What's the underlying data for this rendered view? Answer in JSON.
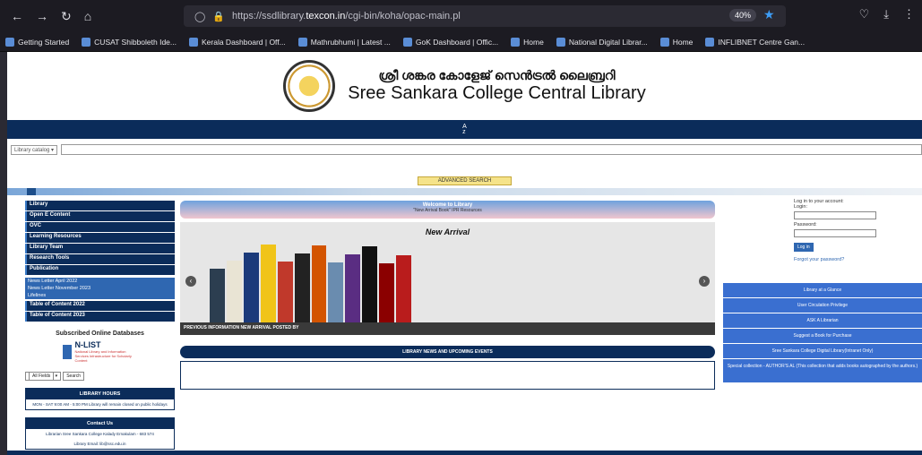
{
  "browser": {
    "url_prefix": "https://ssdlibrary.",
    "url_domain": "texcon.in",
    "url_suffix": "/cgi-bin/koha/opac-main.pl",
    "zoom": "40%"
  },
  "bookmarks": [
    "Getting Started",
    "CUSAT Shibboleth Ide...",
    "Kerala Dashboard | Off...",
    "Mathrubhumi | Latest ...",
    "GoK Dashboard | Offic...",
    "Home",
    "National Digital Librar...",
    "Home",
    "INFLIBNET Centre Gan..."
  ],
  "site": {
    "title_ml": "ശ്രീ ശങ്കര കോളേജ് സെൻട്രൽ ലൈബ്രറി",
    "title_en": "Sree Sankara College Central Library",
    "nav_text": "A\nz"
  },
  "search": {
    "select_label": "Library catalog",
    "advanced": "ADVANCED SEARCH"
  },
  "left": {
    "links": [
      "Library",
      "Open E Content",
      "OVC",
      "Learning Resources",
      "Library Team",
      "Research Tools",
      "Publication"
    ],
    "sublinks": [
      "News Letter April 2022",
      "News Letter November 2023",
      "Lifelines"
    ],
    "links2": [
      "Table of Content 2022",
      "Table of Content 2023"
    ],
    "subscribed": "Subscribed Online Databases",
    "nlist": "N-LIST",
    "nlist_sub": "National Library and Information Services Infrastructure for Scholarly Content",
    "select_value": "All Fields",
    "search_btn": "Search",
    "hours_title": "LIBRARY HOURS",
    "hours_body": "MON - SAT 9:00 AM - 5:00 PM  Library will remain closed on public holidays",
    "contact_title": "Contact Us",
    "contact_body": "Librarian  Sree Sankara College  Kalady  Ernakulam - 683 574",
    "contact_email": "Library Email: lib@ssc.edu.in"
  },
  "center": {
    "head": "Welcome to Library",
    "head_sub": "\"New Arrival Book\"   IPR Resources",
    "arrival": "New Arrival",
    "caption": "PREVIOUS INFORMATION  NEW ARRIVAL POSTED BY",
    "news": "LIBRARY NEWS AND UPCOMING EVENTS"
  },
  "login": {
    "title": "Log in to your account:",
    "login": "Login:",
    "password": "Password:",
    "btn": "Log in",
    "forgot": "Forgot your password?"
  },
  "rightlinks": [
    "Library at a Glance",
    "User Circulation Privilege",
    "ASK A Librarian",
    "Suggest a Book for Purchase",
    "Sree Sankara College Digital Library(Intranet Only)",
    "Special collection - AUTHOR'S AL (This collection that adds books autographed by the authors.)"
  ],
  "book_colors": [
    "#2c3e50",
    "#e9e4d4",
    "#1b3a7a",
    "#f0c419",
    "#c0392b",
    "#222",
    "#d35400",
    "#6a8caf",
    "#5a2d82",
    "#111",
    "#8b0000",
    "#b91c1c"
  ]
}
